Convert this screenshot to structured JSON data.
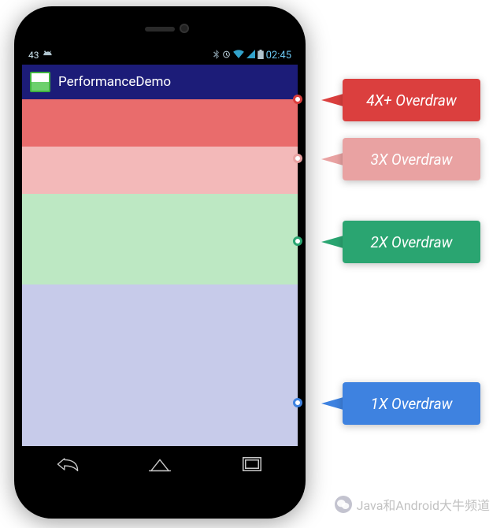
{
  "phone": {
    "status": {
      "notification": "43",
      "time": "02:45"
    },
    "appbar": {
      "title": "PerformanceDemo"
    },
    "zones": {
      "z4x": {
        "color": "#e96c6c"
      },
      "z3x": {
        "color": "#f3b9b9"
      },
      "z2x": {
        "color": "#bde8c3"
      },
      "z1x": {
        "color": "#c7cbea"
      }
    }
  },
  "callouts": {
    "c4x": {
      "label": "4X+ Overdraw",
      "color": "#db3f3e"
    },
    "c3x": {
      "label": "3X Overdraw",
      "color": "#e9a2a2"
    },
    "c2x": {
      "label": "2X Overdraw",
      "color": "#2aa571"
    },
    "c1x": {
      "label": "1X Overdraw",
      "color": "#3e82e0"
    }
  },
  "watermark": {
    "text": "Java和Android大牛频道"
  }
}
